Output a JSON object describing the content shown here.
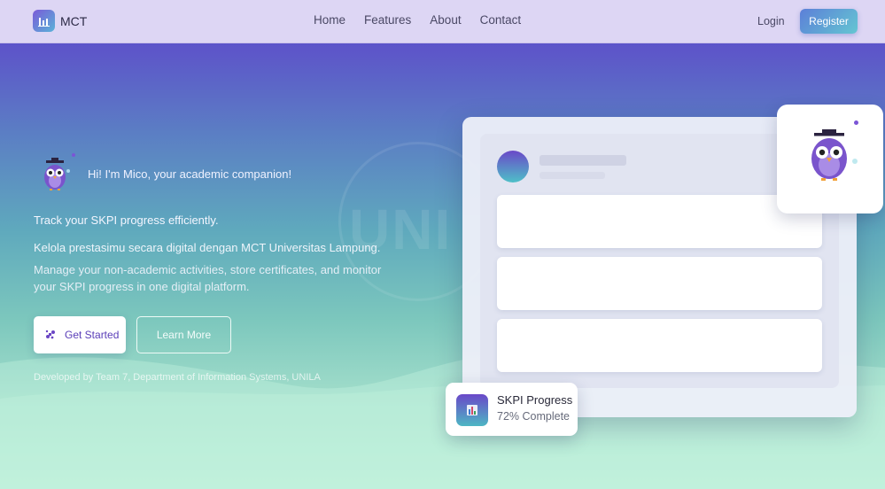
{
  "header": {
    "app_name": "MCT",
    "nav": [
      "Home",
      "Features",
      "About",
      "Contact"
    ],
    "login_label": "Login",
    "register_label": "Register"
  },
  "hero": {
    "greeting": "Hi! I'm Mico, your academic companion!",
    "tagline": "Track your SKPI progress efficiently.",
    "subtitle_id": "Kelola prestasimu secara digital dengan MCT Universitas Lampung.",
    "subtitle_en": "Manage your non-academic activities, store certificates, and monitor your SKPI progress in one digital platform.",
    "get_started_label": "Get Started",
    "learn_more_label": "Learn More",
    "credit": "Developed by Team 7, Department of Information Systems, UNILA",
    "watermark": "UNI"
  },
  "skpi_card": {
    "title": "SKPI Progress",
    "status": "72% Complete"
  },
  "icons": {
    "logo": "bar-chart-icon",
    "get_started": "sparkles-icon",
    "skpi": "bar-chart-icon",
    "mascot": "owl-mascot-icon"
  },
  "colors": {
    "accent_purple": "#5a3eb8",
    "brand_gradient_start": "#6a48c8",
    "brand_gradient_end": "#4ec0c8"
  }
}
